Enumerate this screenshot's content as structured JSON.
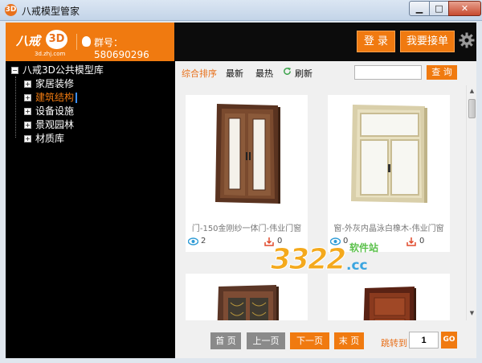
{
  "window": {
    "app_icon": "3D",
    "title": "八戒模型管家",
    "min_label": "▁",
    "max_label": "□",
    "close_label": "✕"
  },
  "header": {
    "logo_text": "八戒",
    "logo_badge": "3D",
    "logo_sub": "3d.zhj.com",
    "group_label": "群号：580690296",
    "login_label": "登 录",
    "order_label": "我要接单",
    "accent_color": "#f07a10"
  },
  "sidebar": {
    "root": {
      "toggle": "−",
      "label": "八戒3D公共模型库"
    },
    "items": [
      {
        "toggle": "+",
        "label": "家居装修"
      },
      {
        "toggle": "+",
        "label": "建筑结构"
      },
      {
        "toggle": "+",
        "label": "设备设施"
      },
      {
        "toggle": "+",
        "label": "景观园林"
      },
      {
        "toggle": "+",
        "label": "材质库"
      }
    ]
  },
  "sortbar": {
    "sort_combined": "综合排序",
    "sort_newest": "最新",
    "sort_hottest": "最热",
    "refresh": "刷新",
    "search_placeholder": "",
    "search_button": "查 询"
  },
  "models": [
    {
      "title": "门-150金刚纱一体门-伟业门窗",
      "views": "2",
      "downloads": "0",
      "kind": "door-brown"
    },
    {
      "title": "窗-外灰内晶泳白橡木-伟业门窗",
      "views": "0",
      "downloads": "0",
      "kind": "window-beige"
    },
    {
      "title": "",
      "views": "",
      "downloads": "",
      "kind": "door-wood-glass"
    },
    {
      "title": "",
      "views": "",
      "downloads": "",
      "kind": "door-red-wood"
    }
  ],
  "pager": {
    "first": "首 页",
    "prev": "上一页",
    "next": "下一页",
    "last": "末 页",
    "jump_label": "跳转到",
    "jump_value": "1",
    "go": "GO"
  },
  "watermark": {
    "main": "3322",
    "site": "软件站",
    "tld": ".cc"
  }
}
